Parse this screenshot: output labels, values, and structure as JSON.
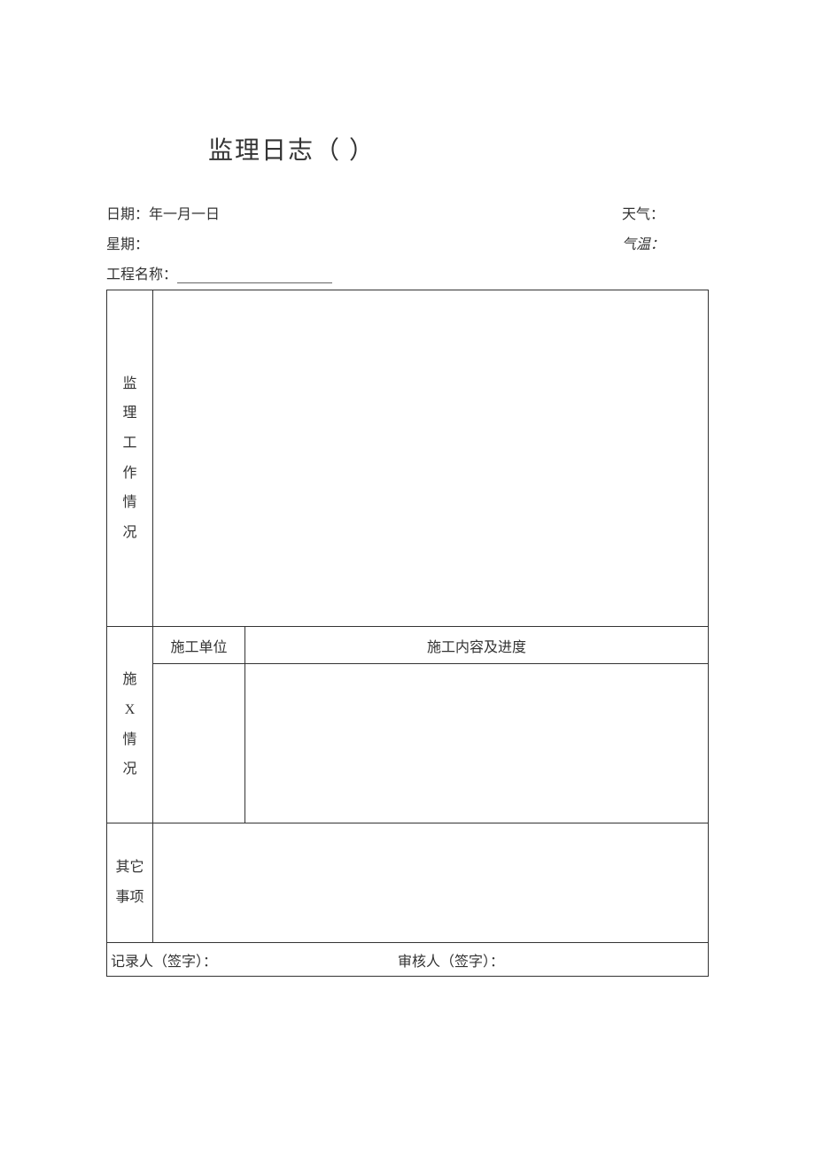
{
  "title": "监理日志（ ）",
  "header": {
    "date_label": "日期：",
    "date_value": "年一月一日",
    "weather_label": "天气：",
    "weekday_label": "星期：",
    "temperature_label": "气温：",
    "project_label": "工程名称："
  },
  "table": {
    "supervision_label": "监理工作情况",
    "construction_label": "施X情况",
    "unit_header": "施工单位",
    "content_header": "施工内容及进度",
    "other_label": "其它事项",
    "recorder_label": "记录人（签字）：",
    "reviewer_label": "审核人（签字）："
  }
}
